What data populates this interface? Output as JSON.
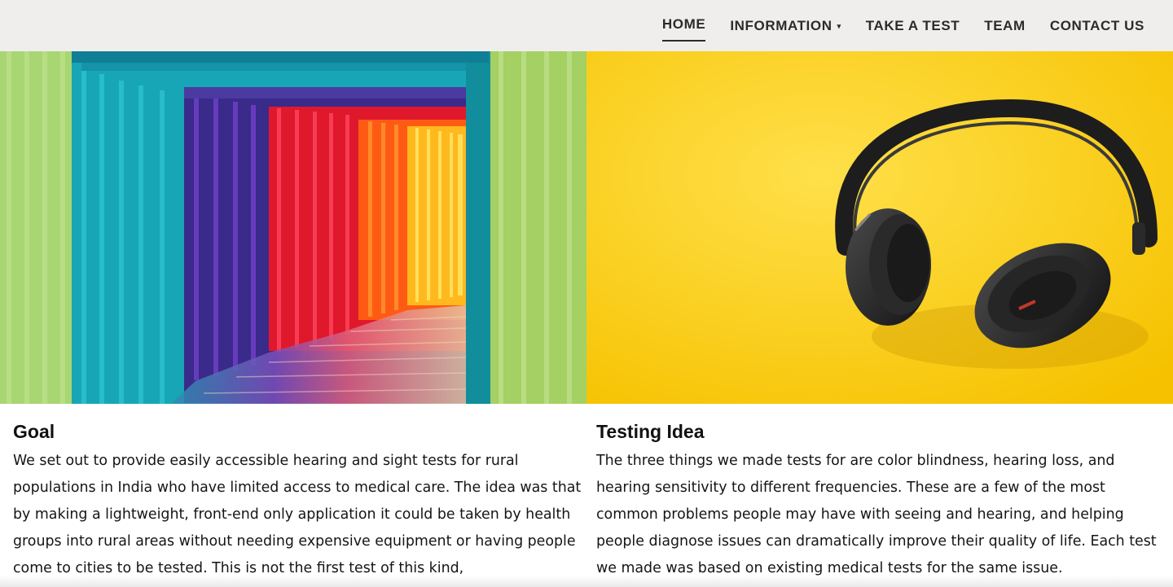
{
  "nav": {
    "items": [
      {
        "label": "HOME",
        "active": true
      },
      {
        "label": "INFORMATION",
        "dropdown": true
      },
      {
        "label": "TAKE A TEST"
      },
      {
        "label": "TEAM"
      },
      {
        "label": "CONTACT US"
      }
    ]
  },
  "sections": {
    "goal": {
      "title": "Goal",
      "body": "We set out to provide easily accessible hearing and sight tests for rural populations in India who have limited access to medical care. The idea was that by making a lightweight, front-end only application it could be taken by health groups into rural areas without needing expensive equipment or having people come to cities to be tested. This is not the first test of this kind,"
    },
    "testing": {
      "title": "Testing Idea",
      "body": "The three things we made tests for are color blindness, hearing loss, and hearing sensitivity to different frequencies. These are a few of the most common problems people may have with seeing and hearing, and helping people diagnose issues can dramatically improve their quality of life. Each test we made was based on existing medical tests for the same issue."
    }
  },
  "colors": {
    "nav_bg": "#efeeec",
    "yellow_bg": "#ffd21a"
  }
}
